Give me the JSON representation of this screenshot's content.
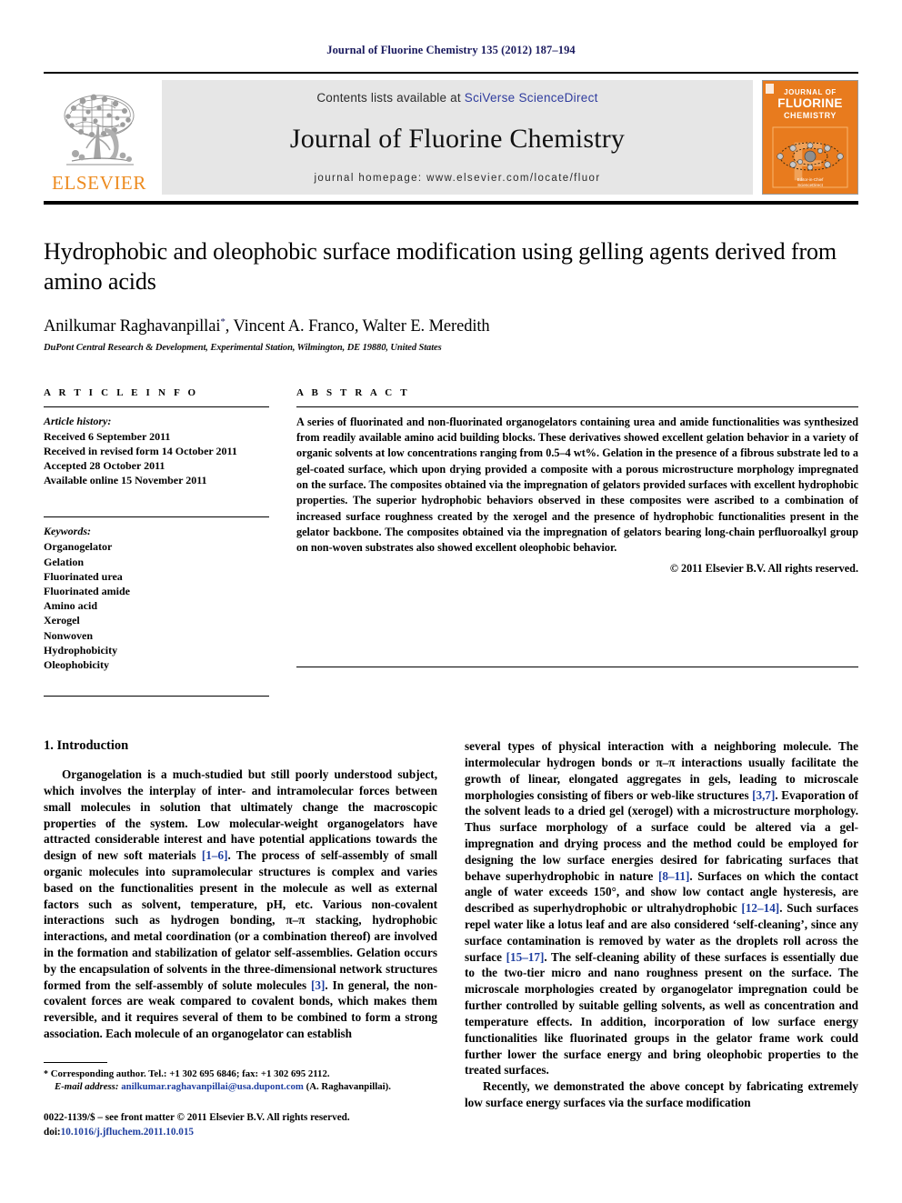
{
  "running_head": "Journal of Fluorine Chemistry 135 (2012) 187–194",
  "banner": {
    "contents_prefix": "Contents lists available at",
    "sciencedirect": "SciVerse ScienceDirect",
    "journal_name": "Journal of Fluorine Chemistry",
    "homepage": "journal homepage: www.elsevier.com/locate/fluor",
    "publisher_wordmark": "ELSEVIER",
    "cover": {
      "line1": "JOURNAL OF",
      "line2": "FLUORINE",
      "line3": "CHEMISTRY",
      "footer1": "Editor-in-Chief",
      "footer2": "ScienceDirect"
    },
    "accent_orange": "#E87B1E",
    "link_blue": "#2f3c9e"
  },
  "article": {
    "title": "Hydrophobic and oleophobic surface modification using gelling agents derived from amino acids",
    "authors": "Anilkumar Raghavanpillai",
    "authors_rest": ", Vincent A. Franco, Walter E. Meredith",
    "corresponding_marker": "*",
    "affiliation": "DuPont Central Research & Development, Experimental Station, Wilmington, DE 19880, United States"
  },
  "article_info": {
    "heading": "A R T I C L E   I N F O",
    "history_label": "Article history:",
    "history": [
      "Received 6 September 2011",
      "Received in revised form 14 October 2011",
      "Accepted 28 October 2011",
      "Available online 15 November 2011"
    ],
    "keywords_label": "Keywords:",
    "keywords": [
      "Organogelator",
      "Gelation",
      "Fluorinated urea",
      "Fluorinated amide",
      "Amino acid",
      "Xerogel",
      "Nonwoven",
      "Hydrophobicity",
      "Oleophobicity"
    ]
  },
  "abstract": {
    "heading": "A B S T R A C T",
    "body": "A series of fluorinated and non-fluorinated organogelators containing urea and amide functionalities was synthesized from readily available amino acid building blocks. These derivatives showed excellent gelation behavior in a variety of organic solvents at low concentrations ranging from 0.5–4 wt%. Gelation in the presence of a fibrous substrate led to a gel-coated surface, which upon drying provided a composite with a porous microstructure morphology impregnated on the surface. The composites obtained via the impregnation of gelators provided surfaces with excellent hydrophobic properties. The superior hydrophobic behaviors observed in these composites were ascribed to a combination of increased surface roughness created by the xerogel and the presence of hydrophobic functionalities present in the gelator backbone. The composites obtained via the impregnation of gelators bearing long-chain perfluoroalkyl group on non-woven substrates also showed excellent oleophobic behavior.",
    "copyright": "© 2011 Elsevier B.V. All rights reserved."
  },
  "introduction": {
    "section_title": "1.  Introduction",
    "left_paragraph_1_a": "Organogelation is a much-studied but still poorly understood subject, which involves the interplay of inter- and intramolecular forces between small molecules in solution that ultimately change the macroscopic properties of the system. Low molecular-weight organogelators have attracted considerable interest and have potential applications towards the design of new soft materials ",
    "ref_1_6": "[1–6]",
    "left_paragraph_1_b": ". The process of self-assembly of small organic molecules into supramolecular structures is complex and varies based on the functionalities present in the molecule as well as external factors such as solvent, temperature, pH, etc. Various non-covalent interactions such as hydrogen bonding, π–π stacking, hydrophobic interactions, and metal coordination (or a combination thereof) are involved in the formation and stabilization of gelator self-assemblies. Gelation occurs by the encapsulation of solvents in the three-dimensional network structures formed from the self-assembly of solute molecules ",
    "ref_3": "[3]",
    "left_paragraph_1_c": ". In general, the non-covalent forces are weak compared to covalent bonds, which makes them reversible, and it requires several of them to be combined to form a strong association. Each molecule of an organogelator can establish",
    "right_paragraph_1_a": "several types of physical interaction with a neighboring molecule. The intermolecular hydrogen bonds or π–π interactions usually facilitate the growth of linear, elongated aggregates in gels, leading to microscale morphologies consisting of fibers or web-like structures ",
    "ref_3_7": "[3,7]",
    "right_paragraph_1_b": ". Evaporation of the solvent leads to a dried gel (xerogel) with a microstructure morphology. Thus surface morphology of a surface could be altered via a gel-impregnation and drying process and the method could be employed for designing the low surface energies desired for fabricating surfaces that behave superhydrophobic in nature ",
    "ref_8_11": "[8–11]",
    "right_paragraph_1_c": ". Surfaces on which the contact angle of water exceeds 150°, and show low contact angle hysteresis, are described as superhydrophobic or ultrahydrophobic ",
    "ref_12_14": "[12–14]",
    "right_paragraph_1_d": ". Such surfaces repel water like a lotus leaf and are also considered ‘self-cleaning’, since any surface contamination is removed by water as the droplets roll across the surface ",
    "ref_15_17": "[15–17]",
    "right_paragraph_1_e": ". The self-cleaning ability of these surfaces is essentially due to the two-tier micro and nano roughness present on the surface. The microscale morphologies created by organogelator impregnation could be further controlled by suitable gelling solvents, as well as concentration and temperature effects. In addition, incorporation of low surface energy functionalities like fluorinated groups in the gelator frame work could further lower the surface energy and bring oleophobic properties to the treated surfaces.",
    "right_paragraph_2": "Recently, we demonstrated the above concept by fabricating extremely low surface energy surfaces via the surface modification"
  },
  "footnotes": {
    "corresponding": "Corresponding author. Tel.: +1 302 695 6846; fax: +1 302 695 2112.",
    "email_label": "E-mail address:",
    "email": "anilkumar.raghavanpillai@usa.dupont.com",
    "email_suffix": "(A. Raghavanpillai).",
    "issn_line": "0022-1139/$ – see front matter © 2011 Elsevier B.V. All rights reserved.",
    "doi_label": "doi:",
    "doi": "10.1016/j.jfluchem.2011.10.015"
  }
}
